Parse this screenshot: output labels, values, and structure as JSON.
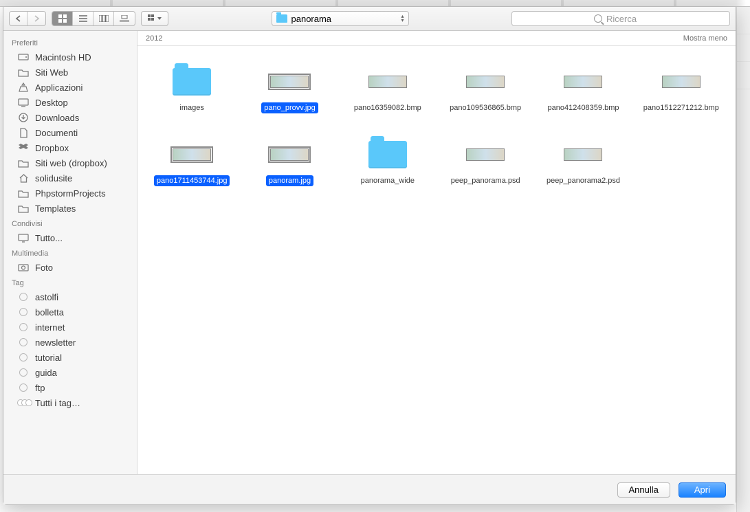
{
  "toolbar": {
    "view_modes": [
      "icon",
      "list",
      "column",
      "coverflow"
    ],
    "active_view": 0,
    "path_label": "panorama",
    "search_placeholder": "Ricerca"
  },
  "crumb": {
    "left": "2012",
    "right": "Mostra meno"
  },
  "sidebar": {
    "sections": [
      {
        "title": "Preferiti",
        "items": [
          {
            "icon": "hdd",
            "label": "Macintosh HD"
          },
          {
            "icon": "folder",
            "label": "Siti Web"
          },
          {
            "icon": "apps",
            "label": "Applicazioni"
          },
          {
            "icon": "desktop",
            "label": "Desktop"
          },
          {
            "icon": "downloads",
            "label": "Downloads"
          },
          {
            "icon": "docs",
            "label": "Documenti"
          },
          {
            "icon": "dropbox",
            "label": "Dropbox"
          },
          {
            "icon": "folder",
            "label": "Siti web (dropbox)"
          },
          {
            "icon": "home",
            "label": "solidusite"
          },
          {
            "icon": "folder",
            "label": "PhpstormProjects"
          },
          {
            "icon": "folder",
            "label": "Templates"
          }
        ]
      },
      {
        "title": "Condivisi",
        "items": [
          {
            "icon": "screen",
            "label": "Tutto..."
          }
        ]
      },
      {
        "title": "Multimedia",
        "items": [
          {
            "icon": "camera",
            "label": "Foto"
          }
        ]
      },
      {
        "title": "Tag",
        "items": [
          {
            "icon": "tag",
            "label": "astolfi"
          },
          {
            "icon": "tag",
            "label": "bolletta"
          },
          {
            "icon": "tag",
            "label": "internet"
          },
          {
            "icon": "tag",
            "label": "newsletter"
          },
          {
            "icon": "tag",
            "label": "tutorial"
          },
          {
            "icon": "tag",
            "label": "guida"
          },
          {
            "icon": "tag",
            "label": "ftp"
          },
          {
            "icon": "alltags",
            "label": "Tutti i tag…"
          }
        ]
      }
    ]
  },
  "files": [
    {
      "type": "folder",
      "label": "images",
      "selected": false
    },
    {
      "type": "image",
      "label": "pano_provv.jpg",
      "selected": true
    },
    {
      "type": "image",
      "label": "pano16359082.bmp",
      "selected": false
    },
    {
      "type": "image",
      "label": "pano109536865.bmp",
      "selected": false
    },
    {
      "type": "image",
      "label": "pano412408359.bmp",
      "selected": false
    },
    {
      "type": "image",
      "label": "pano1512271212.bmp",
      "selected": false
    },
    {
      "type": "image",
      "label": "pano1711453744.jpg",
      "selected": true
    },
    {
      "type": "image",
      "label": "panoram.jpg",
      "selected": true
    },
    {
      "type": "folder",
      "label": "panorama_wide",
      "selected": false
    },
    {
      "type": "image",
      "label": "peep_panorama.psd",
      "selected": false
    },
    {
      "type": "image",
      "label": "peep_panorama2.psd",
      "selected": false
    }
  ],
  "footer": {
    "cancel": "Annulla",
    "open": "Apri"
  }
}
